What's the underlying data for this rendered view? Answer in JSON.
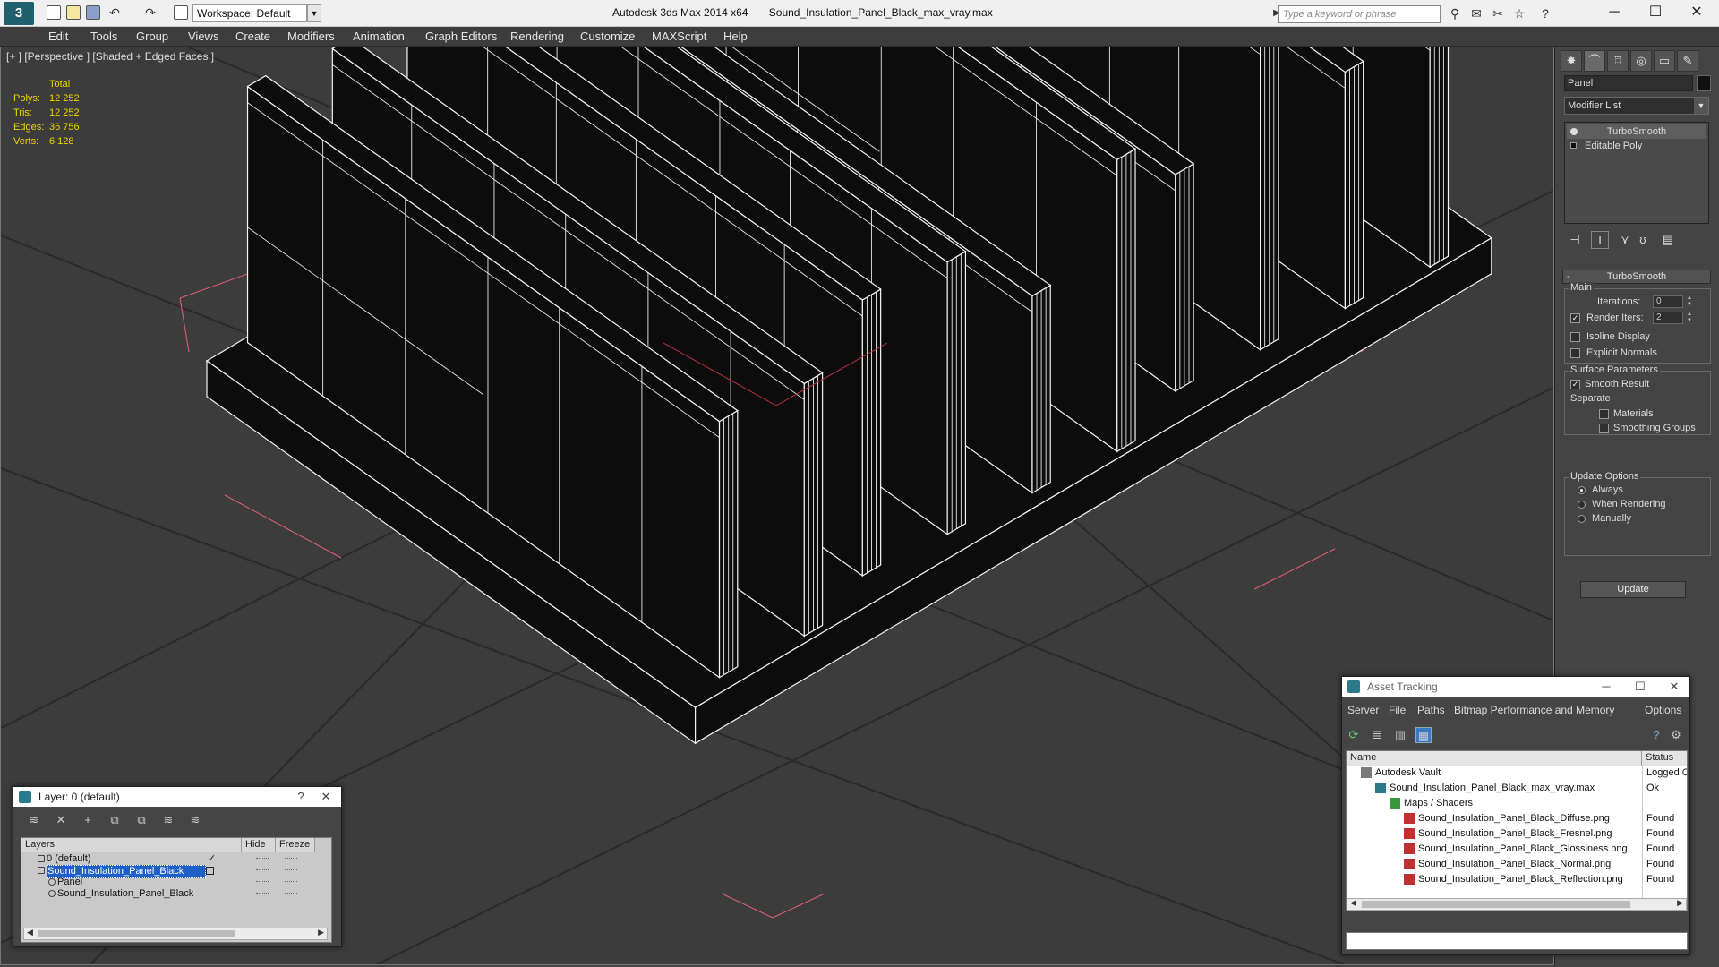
{
  "titlebar": {
    "workspace": "Workspace: Default",
    "app_name": "Autodesk 3ds Max  2014 x64",
    "file_name": "Sound_Insulation_Panel_Black_max_vray.max",
    "search_placeholder": "Type a keyword or phrase",
    "minimize": "─",
    "maximize": "☐",
    "close": "✕"
  },
  "menu": [
    "Edit",
    "Tools",
    "Group",
    "Views",
    "Create",
    "Modifiers",
    "Animation",
    "Graph Editors",
    "Rendering",
    "Customize",
    "MAXScript",
    "Help"
  ],
  "viewport": {
    "label": "[+ ] [Perspective ] [Shaded + Edged Faces ]",
    "stats": {
      "header": "Total",
      "rows": [
        {
          "label": "Polys:",
          "value": "12 252"
        },
        {
          "label": "Tris:",
          "value": "12 252"
        },
        {
          "label": "Edges:",
          "value": "36 756"
        },
        {
          "label": "Verts:",
          "value": "6 128"
        }
      ]
    },
    "colors": {
      "background": "#3c3c3c",
      "grid": "#2a2a2a",
      "wire": "#ffffff",
      "fill": "#0c0c0c",
      "bbox": "#e0607a",
      "stats": "#f2d600"
    }
  },
  "command_panel": {
    "object_name": "Panel",
    "modifier_list": "Modifier List",
    "stack": [
      "TurboSmooth",
      "Editable Poly"
    ],
    "rollout_title": "TurboSmooth",
    "main_group": "Main",
    "iterations_label": "Iterations:",
    "iterations_value": "0",
    "render_iters_label": "Render Iters:",
    "render_iters_value": "2",
    "isoline_display": "Isoline Display",
    "explicit_normals": "Explicit Normals",
    "surface_params": "Surface Parameters",
    "smooth_result": "Smooth Result",
    "separate": "Separate",
    "materials": "Materials",
    "smoothing_groups": "Smoothing Groups",
    "update_options": "Update Options",
    "always": "Always",
    "when_rendering": "When Rendering",
    "manually": "Manually",
    "update_button": "Update"
  },
  "layer_window": {
    "title": "Layer: 0 (default)",
    "help": "?",
    "close": "✕",
    "col_layers": "Layers",
    "col_hide": "Hide",
    "col_freeze": "Freeze",
    "rows": [
      {
        "name": "0 (default)",
        "indent": 0,
        "selected": false,
        "active": true
      },
      {
        "name": "Sound_Insulation_Panel_Black",
        "indent": 0,
        "selected": true,
        "active": false
      },
      {
        "name": "Panel",
        "indent": 1,
        "selected": false,
        "active": false
      },
      {
        "name": "Sound_Insulation_Panel_Black",
        "indent": 1,
        "selected": false,
        "active": false
      }
    ]
  },
  "asset_window": {
    "title": "Asset Tracking",
    "menu": [
      "Server",
      "File",
      "Paths",
      "Bitmap Performance and Memory",
      "Options"
    ],
    "col_name": "Name",
    "col_status": "Status",
    "rows": [
      {
        "name": "Autodesk Vault",
        "status": "Logged O",
        "indent": 0,
        "icon": "vault"
      },
      {
        "name": "Sound_Insulation_Panel_Black_max_vray.max",
        "status": "Ok",
        "indent": 1,
        "icon": "max"
      },
      {
        "name": "Maps / Shaders",
        "status": "",
        "indent": 2,
        "icon": "maps"
      },
      {
        "name": "Sound_Insulation_Panel_Black_Diffuse.png",
        "status": "Found",
        "indent": 3,
        "icon": "png"
      },
      {
        "name": "Sound_Insulation_Panel_Black_Fresnel.png",
        "status": "Found",
        "indent": 3,
        "icon": "png"
      },
      {
        "name": "Sound_Insulation_Panel_Black_Glossiness.png",
        "status": "Found",
        "indent": 3,
        "icon": "png"
      },
      {
        "name": "Sound_Insulation_Panel_Black_Normal.png",
        "status": "Found",
        "indent": 3,
        "icon": "png"
      },
      {
        "name": "Sound_Insulation_Panel_Black_Reflection.png",
        "status": "Found",
        "indent": 3,
        "icon": "png"
      }
    ]
  }
}
